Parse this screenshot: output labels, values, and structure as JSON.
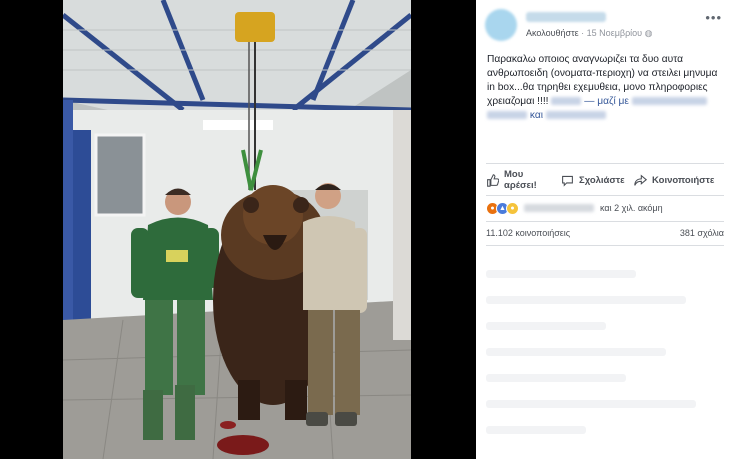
{
  "post": {
    "follow_label": "Ακολουθήστε",
    "date": "15 Νοεμβρίου",
    "text_main": "Παρακαλω οποιος αναγνωριζει τα δυο αυτα ανθρωποειδη (ονοματα-περιοχη) να στειλει μηνυμα in box...θα τηρηθει εχεμυθεια, μονο πληροφοριες χρειαζομαι !!!!",
    "with_label": "— μαζί με",
    "and_label": "και"
  },
  "actions": {
    "like_line1": "Μου",
    "like_line2": "αρέσει!",
    "comment_label": "Σχολιάστε",
    "share_label": "Κοινοποιήστε"
  },
  "reactions": {
    "others_text": "και 2 χιλ. ακόμη"
  },
  "stats": {
    "shares": "11.102 κοινοποιήσεις",
    "comments": "381 σχόλια"
  },
  "colors": {
    "link": "#365899",
    "reaction_like": "#4a7bdb",
    "reaction_angry": "#e9710f",
    "reaction_sad": "#f5c33b"
  }
}
